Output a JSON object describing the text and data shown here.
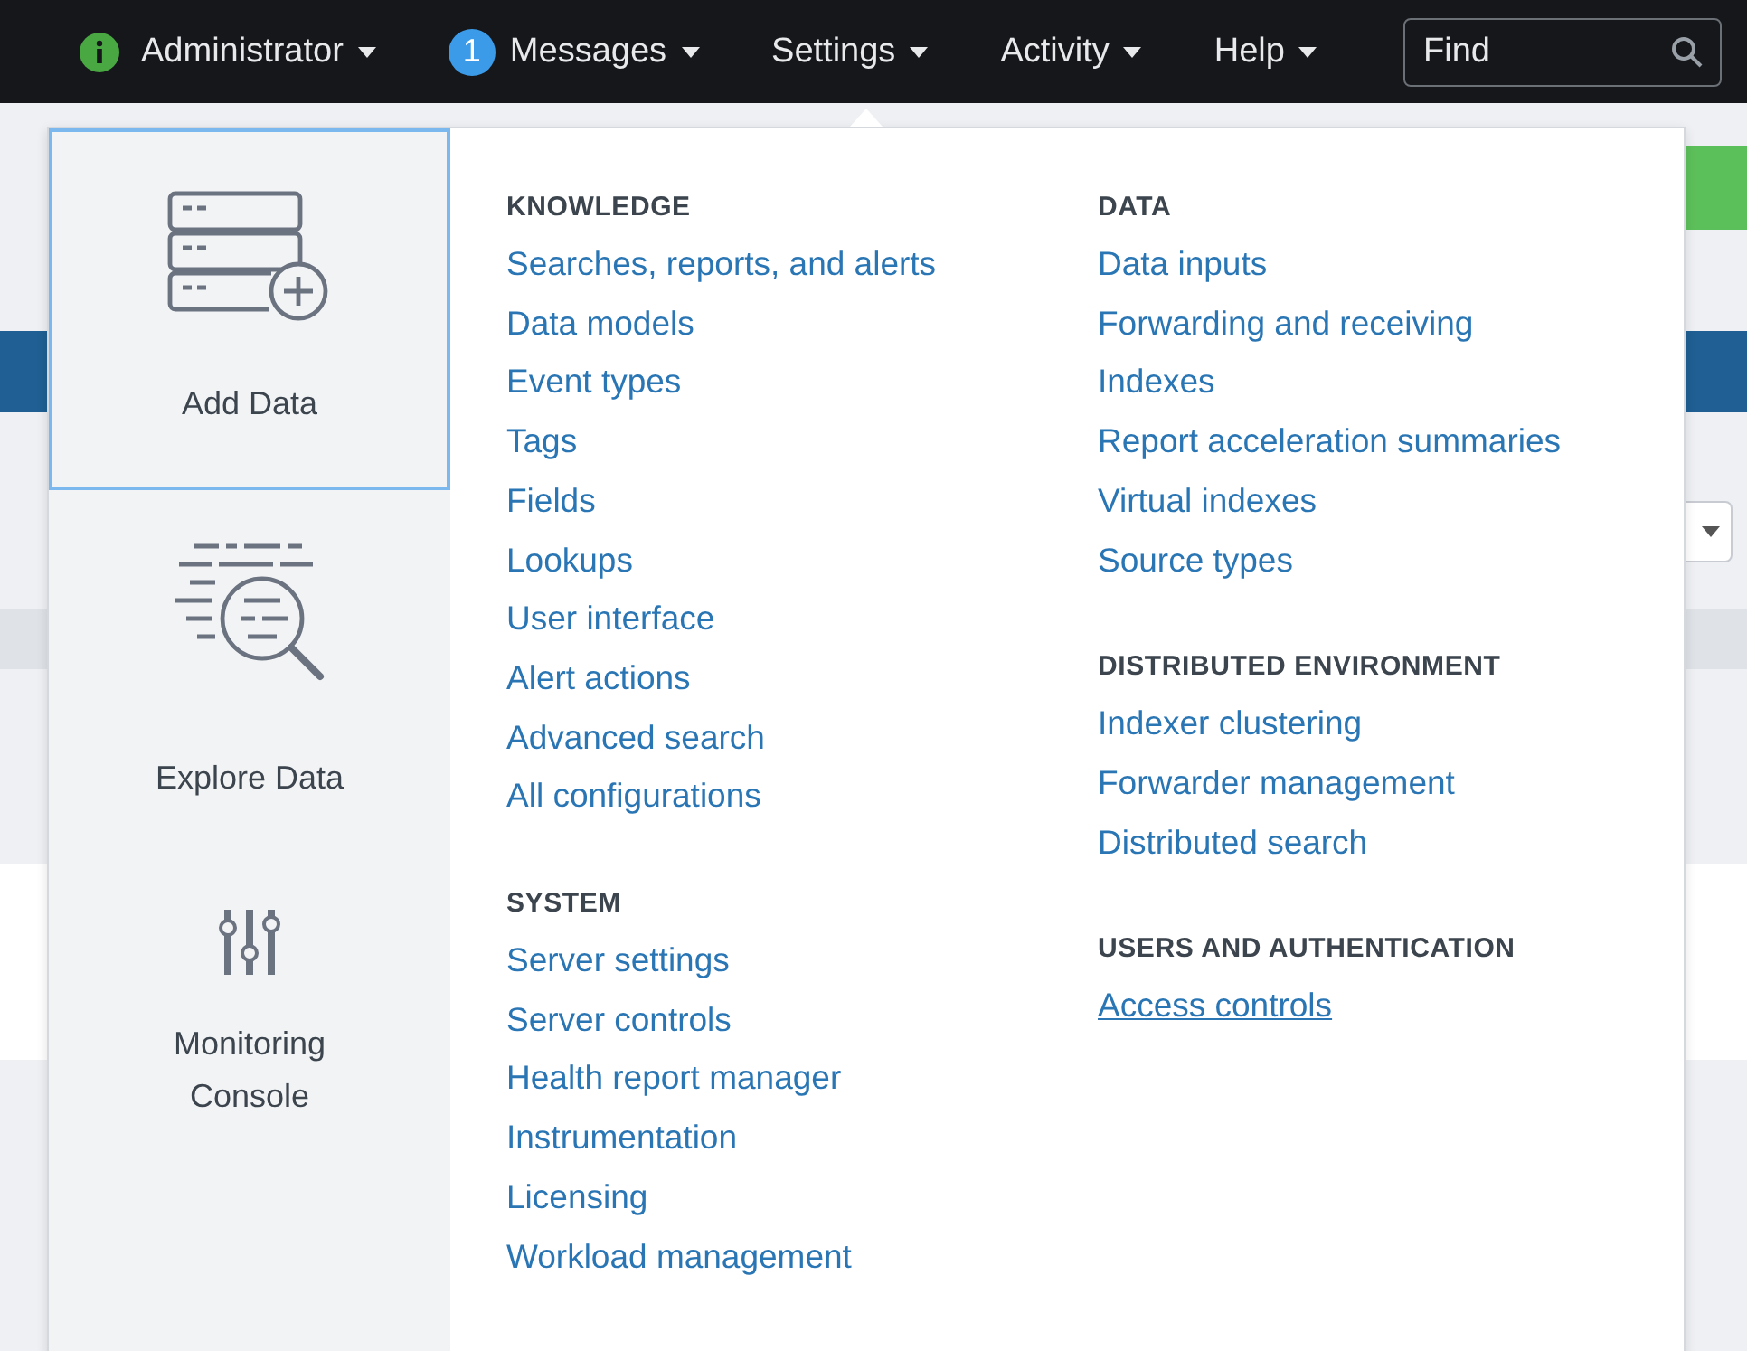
{
  "nav": {
    "items": [
      {
        "kind": "status",
        "label": "Administrator"
      },
      {
        "kind": "messages",
        "badge": "1",
        "label": "Messages"
      },
      {
        "kind": "menu",
        "label": "Settings"
      },
      {
        "kind": "menu",
        "label": "Activity"
      },
      {
        "kind": "menu",
        "label": "Help"
      }
    ],
    "search": {
      "placeholder": "Find"
    }
  },
  "settings_menu": {
    "shortcuts": [
      {
        "kind": "add-data",
        "label": "Add Data",
        "selected": true
      },
      {
        "kind": "explore",
        "label": "Explore Data",
        "selected": false
      },
      {
        "kind": "monitoring",
        "label": "Monitoring Console",
        "selected": false
      }
    ],
    "columns": [
      {
        "sections": [
          {
            "heading": "KNOWLEDGE",
            "links": [
              {
                "label": "Searches, reports, and alerts",
                "hovered": false
              },
              {
                "label": "Data models",
                "hovered": false
              },
              {
                "label": "Event types",
                "hovered": false
              },
              {
                "label": "Tags",
                "hovered": false
              },
              {
                "label": "Fields",
                "hovered": false
              },
              {
                "label": "Lookups",
                "hovered": false
              },
              {
                "label": "User interface",
                "hovered": false
              },
              {
                "label": "Alert actions",
                "hovered": false
              },
              {
                "label": "Advanced search",
                "hovered": false
              },
              {
                "label": "All configurations",
                "hovered": false
              }
            ]
          },
          {
            "heading": "SYSTEM",
            "links": [
              {
                "label": "Server settings",
                "hovered": false
              },
              {
                "label": "Server controls",
                "hovered": false
              },
              {
                "label": "Health report manager",
                "hovered": false
              },
              {
                "label": "Instrumentation",
                "hovered": false
              },
              {
                "label": "Licensing",
                "hovered": false
              },
              {
                "label": "Workload management",
                "hovered": false
              }
            ]
          }
        ]
      },
      {
        "sections": [
          {
            "heading": "DATA",
            "links": [
              {
                "label": "Data inputs",
                "hovered": false
              },
              {
                "label": "Forwarding and receiving",
                "hovered": false
              },
              {
                "label": "Indexes",
                "hovered": false
              },
              {
                "label": "Report acceleration summaries",
                "hovered": false
              },
              {
                "label": "Virtual indexes",
                "hovered": false
              },
              {
                "label": "Source types",
                "hovered": false
              }
            ]
          },
          {
            "heading": "DISTRIBUTED ENVIRONMENT",
            "links": [
              {
                "label": "Indexer clustering",
                "hovered": false
              },
              {
                "label": "Forwarder management",
                "hovered": false
              },
              {
                "label": "Distributed search",
                "hovered": false
              }
            ]
          },
          {
            "heading": "USERS AND AUTHENTICATION",
            "links": [
              {
                "label": "Access controls",
                "hovered": true
              }
            ]
          }
        ]
      }
    ]
  }
}
